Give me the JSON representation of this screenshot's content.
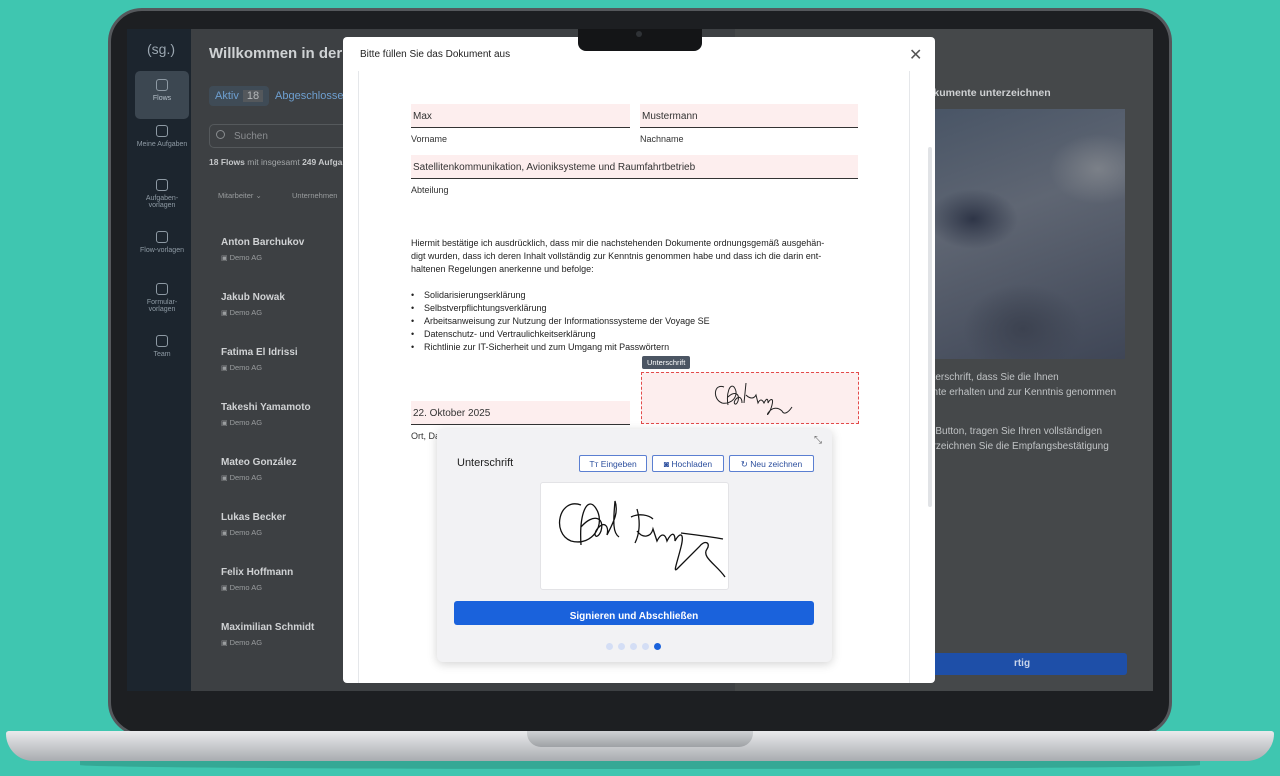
{
  "app": {
    "logo": "(sg.)",
    "nav": [
      {
        "label": "Flows",
        "icon": "flows-icon"
      },
      {
        "label": "Meine Aufgaben",
        "icon": "tasks-icon"
      },
      {
        "label": "Aufgaben-vorlagen",
        "icon": "task-templates-icon"
      },
      {
        "label": "Flow-vorlagen",
        "icon": "flow-templates-icon"
      },
      {
        "label": "Formular-vorlagen",
        "icon": "form-templates-icon"
      },
      {
        "label": "Team",
        "icon": "team-icon"
      }
    ],
    "welcome": "Willkommen in der O",
    "tab_active": "Aktiv",
    "tab_active_count": "18",
    "tab_done": "Abgeschlossen",
    "search_placeholder": "Suchen",
    "flows_count_a": "18 Flows",
    "flows_count_b": " mit insgesamt ",
    "flows_count_c": "249 Aufga",
    "columns": [
      "Mitarbeiter",
      "Unternehmen"
    ],
    "people": [
      {
        "name": "Anton Barchukov",
        "company": "Demo AG"
      },
      {
        "name": "Jakub Nowak",
        "company": "Demo AG"
      },
      {
        "name": "Fatima El Idrissi",
        "company": "Demo AG"
      },
      {
        "name": "Takeshi Yamamoto",
        "company": "Demo AG"
      },
      {
        "name": "Mateo González",
        "company": "Demo AG"
      },
      {
        "name": "Lukas Becker",
        "company": "Demo AG"
      },
      {
        "name": "Felix Hoffmann",
        "company": "Demo AG"
      },
      {
        "name": "Maximilian Schmidt",
        "company": "Demo AG"
      }
    ],
    "right_title": "okumente unterzeichnen",
    "right_text": [
      "nterschrift, dass Sie die Ihnen",
      "ente erhalten und zur Kenntnis genommen",
      "n Button, tragen Sie Ihren vollständigen",
      "erzeichnen Sie die Empfangsbestätigung"
    ],
    "right_button": "rtig"
  },
  "modal": {
    "title": "Bitte füllen Sie das Dokument aus",
    "close_icon": "close-icon",
    "fields": {
      "vorname_value": "Max",
      "vorname_label": "Vorname",
      "nachname_value": "Mustermann",
      "nachname_label": "Nachname",
      "abteilung_value": "Satellitenkommunikation, Avioniksysteme und Raumfahrtbetrieb",
      "abteilung_label": "Abteilung",
      "date_value": "22. Oktober 2025",
      "ort_label": "Ort, Da"
    },
    "paragraph": [
      "Hiermit bestätige ich ausdrücklich, dass mir die nachstehenden Dokumente ordnungsgemäß ausgehän-",
      "digt wurden, dass ich deren Inhalt vollständig zur Kenntnis genommen habe und dass ich die darin ent-",
      "haltenen Regelungen anerkenne und befolge:"
    ],
    "documents": [
      "Solidarisierungserklärung",
      "Selbstverpflichtungsverklärung",
      "Arbeitsanweisung zur Nutzung der Informationssysteme der Voyage SE",
      "Datenschutz- und Vertraulichkeitserklärung",
      "Richtlinie zur IT-Sicherheit und zum Umgang mit Passwörtern"
    ],
    "signature_tag": "Unterschrift"
  },
  "signature_popup": {
    "title": "Unterschrift",
    "btn_type": "Eingeben",
    "btn_upload": "Hochladen",
    "btn_redraw": "Neu zeichnen",
    "submit": "Signieren und Abschließen",
    "steps_total": 5,
    "step_current": 5,
    "accent": "#1a62dc"
  }
}
